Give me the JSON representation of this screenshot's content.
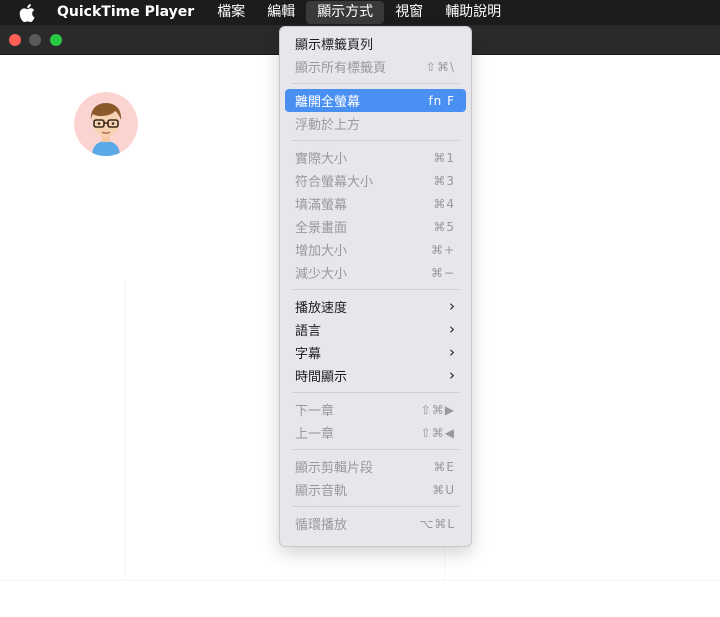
{
  "menubar": {
    "apple_icon": "apple-logo-icon",
    "app_name": "QuickTime Player",
    "items": [
      "檔案",
      "編輯",
      "顯示方式",
      "視窗",
      "輔助說明"
    ],
    "active_index": 2
  },
  "window": {
    "controls": [
      "close",
      "minimize",
      "zoom"
    ]
  },
  "view_menu": {
    "groups": [
      [
        {
          "label": "顯示標籤頁列",
          "shortcut": "",
          "enabled": true
        },
        {
          "label": "顯示所有標籤頁",
          "shortcut": "⇧⌘\\",
          "enabled": false
        }
      ],
      [
        {
          "label": "離開全螢幕",
          "shortcut": "fn F",
          "enabled": true,
          "selected": true
        },
        {
          "label": "浮動於上方",
          "shortcut": "",
          "enabled": false
        }
      ],
      [
        {
          "label": "實際大小",
          "shortcut": "⌘1",
          "enabled": false
        },
        {
          "label": "符合螢幕大小",
          "shortcut": "⌘3",
          "enabled": false
        },
        {
          "label": "填滿螢幕",
          "shortcut": "⌘4",
          "enabled": false
        },
        {
          "label": "全景畫面",
          "shortcut": "⌘5",
          "enabled": false
        },
        {
          "label": "增加大小",
          "shortcut": "⌘+",
          "enabled": false
        },
        {
          "label": "減少大小",
          "shortcut": "⌘−",
          "enabled": false
        }
      ],
      [
        {
          "label": "播放速度",
          "submenu": true,
          "enabled": true
        },
        {
          "label": "語言",
          "submenu": true,
          "enabled": true
        },
        {
          "label": "字幕",
          "submenu": true,
          "enabled": true
        },
        {
          "label": "時間顯示",
          "submenu": true,
          "enabled": true
        }
      ],
      [
        {
          "label": "下一章",
          "shortcut": "⇧⌘▶",
          "enabled": false
        },
        {
          "label": "上一章",
          "shortcut": "⇧⌘◀",
          "enabled": false
        }
      ],
      [
        {
          "label": "顯示剪輯片段",
          "shortcut": "⌘E",
          "enabled": false
        },
        {
          "label": "顯示音軌",
          "shortcut": "⌘U",
          "enabled": false
        }
      ],
      [
        {
          "label": "循環播放",
          "shortcut": "⌥⌘L",
          "enabled": false
        }
      ]
    ]
  },
  "colors": {
    "menubar_bg": "#1c1c1e",
    "menu_bg": "#e8e6ea",
    "highlight": "#4a8ff2",
    "disabled_text": "#9a989d",
    "close_light": "#ff5f57",
    "zoom_light": "#28c840"
  }
}
